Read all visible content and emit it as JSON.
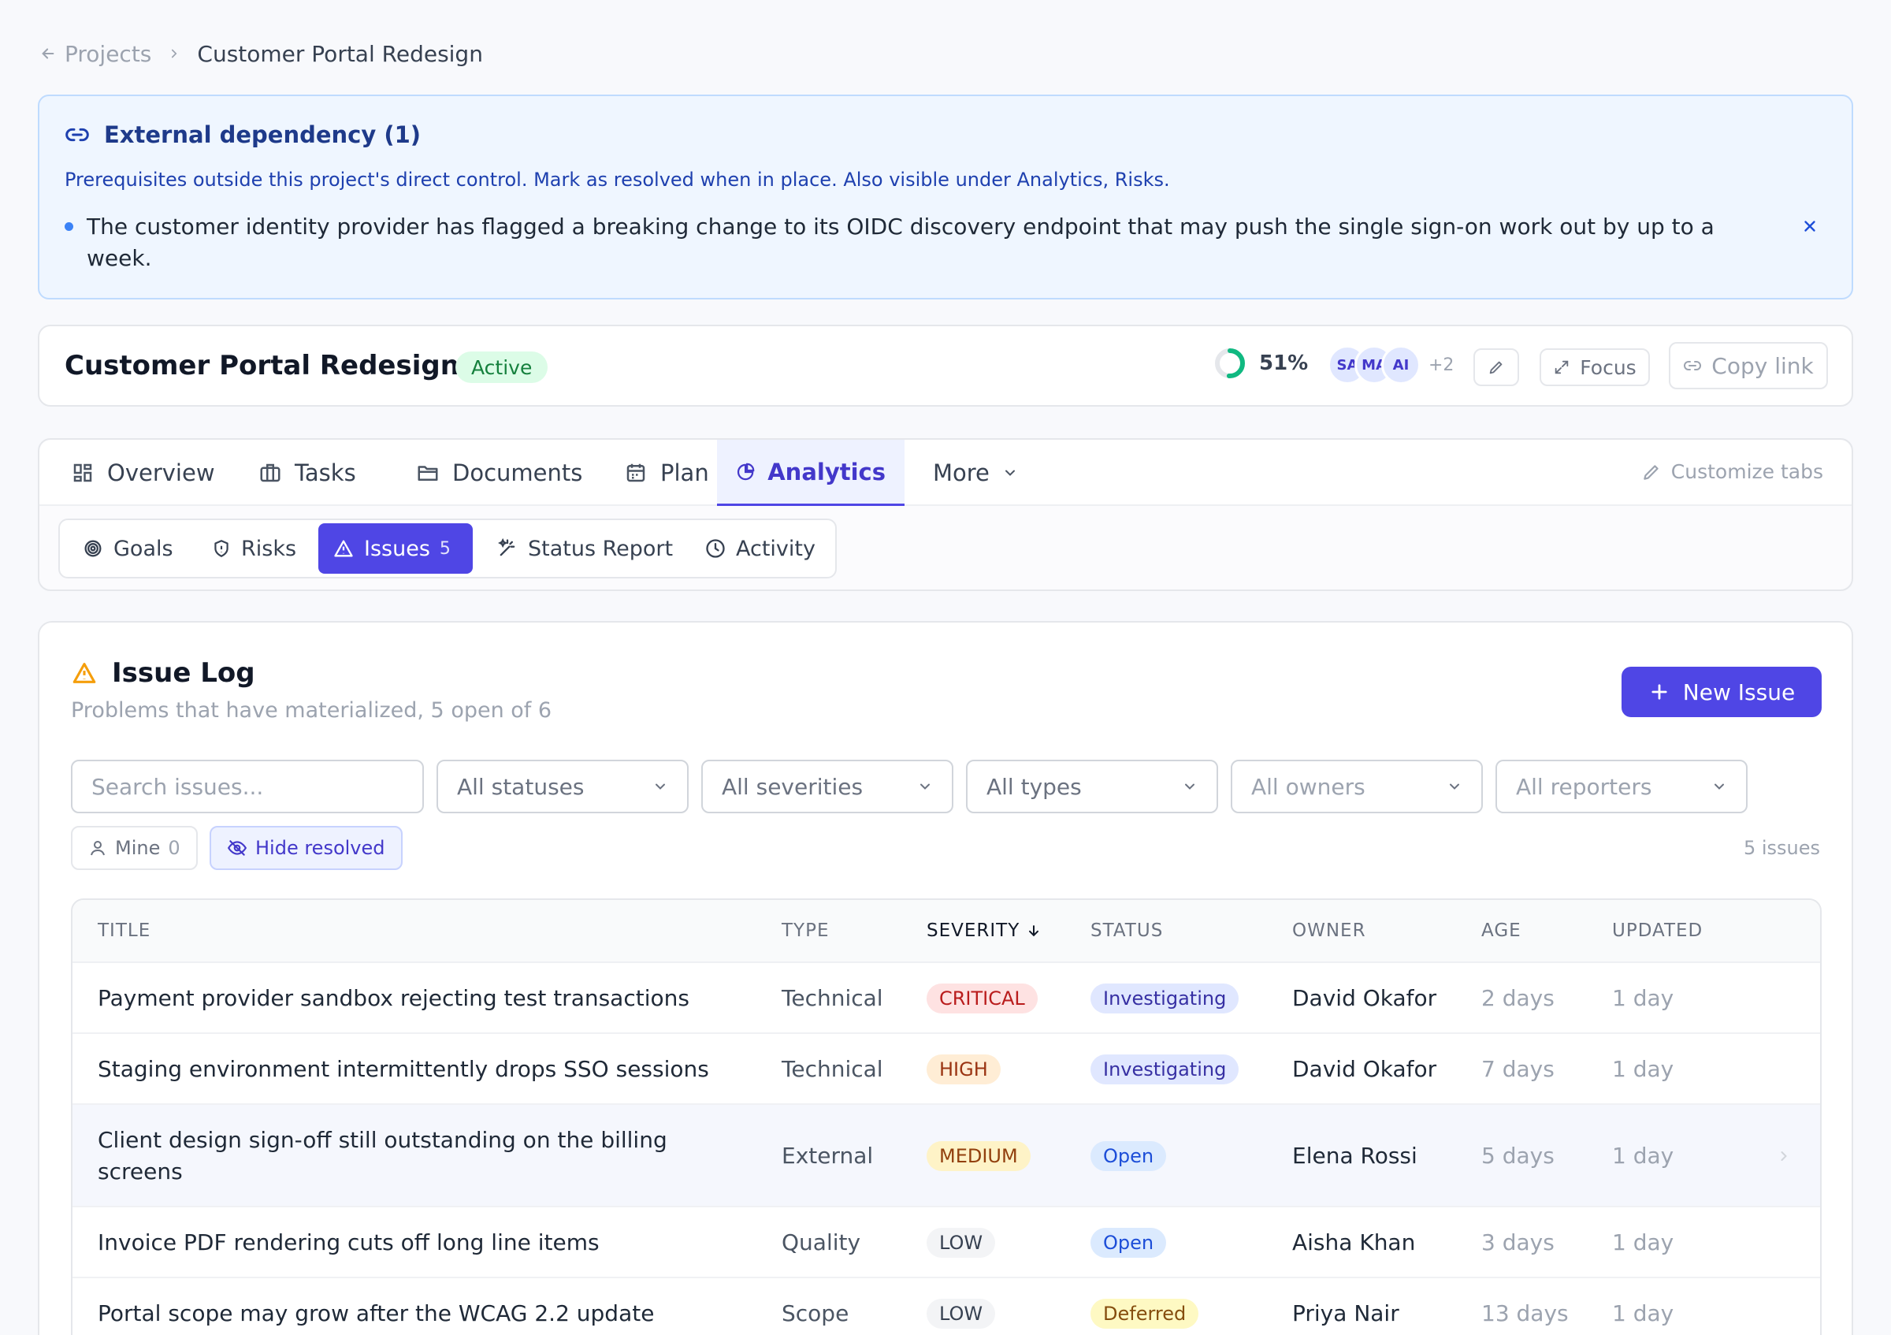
{
  "breadcrumb": {
    "parent": "Projects",
    "current": "Customer Portal Redesign"
  },
  "alert": {
    "title": "External dependency (1)",
    "description": "Prerequisites outside this project's direct control. Mark as resolved when in place. Also visible under Analytics, Risks.",
    "item": "The customer identity provider has flagged a breaking change to its OIDC discovery endpoint that may push the single sign-on work out by up to a week."
  },
  "project": {
    "title": "Customer Portal Redesign",
    "status": "Active",
    "progress_label": "51%",
    "progress_value": 0.51,
    "avatars": [
      "SA",
      "MA",
      "AI"
    ],
    "more_members": "+2",
    "focus_label": "Focus",
    "copy_link_label": "Copy link"
  },
  "tabs": [
    {
      "label": "Overview",
      "icon": "dashboard-icon"
    },
    {
      "label": "Tasks",
      "icon": "briefcase-icon"
    },
    {
      "label": "Documents",
      "icon": "folder-icon"
    },
    {
      "label": "Plan",
      "icon": "calendar-icon"
    },
    {
      "label": "Analytics",
      "icon": "pie-chart-icon",
      "active": true
    },
    {
      "label": "More",
      "icon": "chevron-down-icon"
    }
  ],
  "customize_tabs": "Customize tabs",
  "subtabs": [
    {
      "label": "Goals",
      "icon": "target-icon"
    },
    {
      "label": "Risks",
      "icon": "shield-icon"
    },
    {
      "label": "Issues",
      "icon": "warning-icon",
      "count": "5",
      "active": true
    },
    {
      "label": "Status Report",
      "icon": "sparkles-icon"
    },
    {
      "label": "Activity",
      "icon": "clock-icon"
    }
  ],
  "issue_log": {
    "title": "Issue Log",
    "subtitle": "Problems that have materialized, 5 open of 6",
    "new_button": "New Issue",
    "search_placeholder": "Search issues...",
    "filters": [
      "All statuses",
      "All severities",
      "All types",
      "All owners",
      "All reporters"
    ],
    "mine_label": "Mine",
    "mine_count": "0",
    "hide_resolved": "Hide resolved",
    "count_label": "5 issues"
  },
  "table": {
    "columns": [
      "TITLE",
      "TYPE",
      "SEVERITY",
      "STATUS",
      "OWNER",
      "AGE",
      "UPDATED"
    ],
    "rows": [
      {
        "title": "Payment provider sandbox rejecting test transactions",
        "type": "Technical",
        "severity": "CRITICAL",
        "status": "Investigating",
        "owner": "David Okafor",
        "age": "2 days",
        "updated": "1 day"
      },
      {
        "title": "Staging environment intermittently drops SSO sessions",
        "type": "Technical",
        "severity": "HIGH",
        "status": "Investigating",
        "owner": "David Okafor",
        "age": "7 days",
        "updated": "1 day"
      },
      {
        "title": "Client design sign-off still outstanding on the billing screens",
        "type": "External",
        "severity": "MEDIUM",
        "status": "Open",
        "owner": "Elena Rossi",
        "age": "5 days",
        "updated": "1 day"
      },
      {
        "title": "Invoice PDF rendering cuts off long line items",
        "type": "Quality",
        "severity": "LOW",
        "status": "Open",
        "owner": "Aisha Khan",
        "age": "3 days",
        "updated": "1 day"
      },
      {
        "title": "Portal scope may grow after the WCAG 2.2 update",
        "type": "Scope",
        "severity": "LOW",
        "status": "Deferred",
        "owner": "Priya Nair",
        "age": "13 days",
        "updated": "1 day"
      }
    ]
  },
  "colors": {
    "accent": "#4f46e5",
    "critical_bg": "#fee2e2",
    "critical_fg": "#b91c1c",
    "high_bg": "#ffedd5",
    "high_fg": "#9a3412",
    "medium_bg": "#fef3c7",
    "medium_fg": "#92400e",
    "low_bg": "#f3f4f6",
    "low_fg": "#374151",
    "investigating_bg": "#e0e7ff",
    "investigating_fg": "#3730a3",
    "open_bg": "#dbeafe",
    "open_fg": "#1d4ed8",
    "deferred_bg": "#fef9c3",
    "deferred_fg": "#854d0e"
  }
}
